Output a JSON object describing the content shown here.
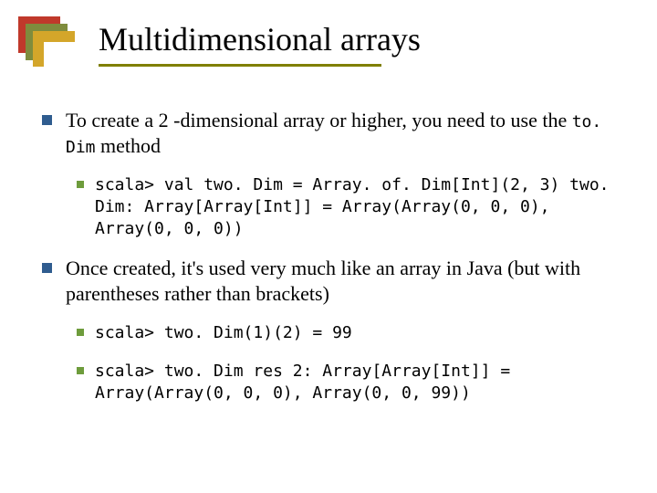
{
  "title": "Multidimensional arrays",
  "bullets": {
    "b1": {
      "pre": "To create a 2 -dimensional array or higher, you need to use the ",
      "code": "to. Dim",
      "post": " method"
    },
    "b1a": "scala> val two. Dim = Array. of. Dim[Int](2, 3) two. Dim: Array[Array[Int]] = Array(Array(0, 0, 0), Array(0, 0, 0))",
    "b2": "Once created, it's used very much like an array in Java (but with parentheses rather than brackets)",
    "b2a_pre": "scala> ",
    "b2a_code": "two. Dim(1)(2) = 99",
    "b2b_pre": "scala> ",
    "b2b_code": "two. Dim",
    "b2b_rest": " res 2: Array[Array[Int]] = Array(Array(0, 0, 0), Array(0, 0, 99))"
  }
}
